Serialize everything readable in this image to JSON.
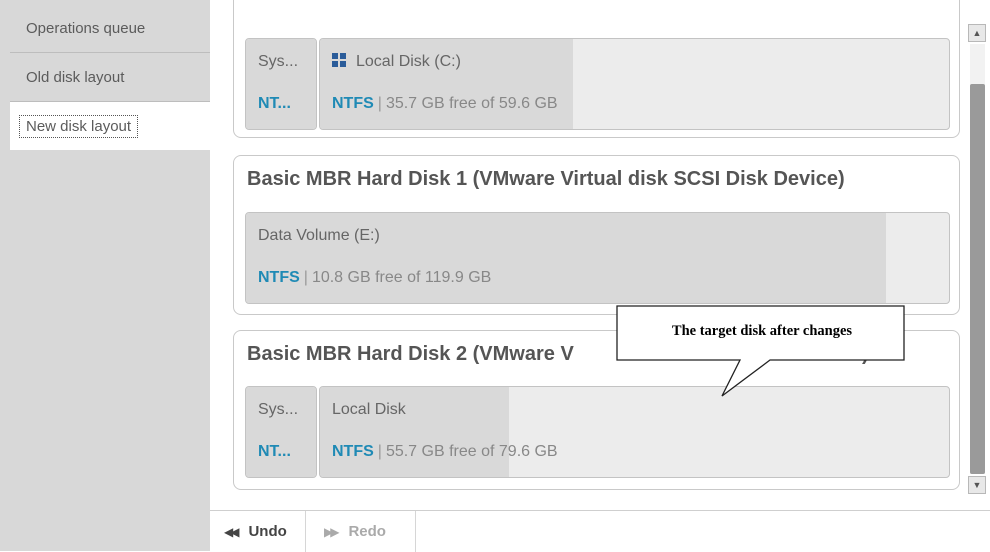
{
  "sidebar": {
    "tabs": [
      {
        "label": "Operations queue"
      },
      {
        "label": "Old disk layout"
      },
      {
        "label": "New disk layout",
        "selected": true
      }
    ]
  },
  "disks": [
    {
      "title": "",
      "partitions": [
        {
          "name": "Sys...",
          "fs": "NT...",
          "detail": "",
          "used_fraction": 1.0
        },
        {
          "name": "Local Disk (C:)",
          "icon": "windows-icon",
          "fs": "NTFS",
          "detail": "35.7 GB free of 59.6 GB",
          "used_fraction": 0.4
        }
      ]
    },
    {
      "title": "Basic MBR Hard Disk 1 (VMware Virtual disk SCSI Disk Device)",
      "partitions": [
        {
          "name": "Data Volume (E:)",
          "fs": "NTFS",
          "detail": "10.8 GB free of 119.9 GB",
          "used_fraction": 0.91
        }
      ]
    },
    {
      "title_left": "Basic MBR Hard Disk 2 (VMware V",
      "title_right": "ce)",
      "partitions": [
        {
          "name": "Sys...",
          "fs": "NT...",
          "detail": "",
          "used_fraction": 1.0
        },
        {
          "name": "Local Disk",
          "fs": "NTFS",
          "detail": "55.7 GB free of 79.6 GB",
          "used_fraction": 0.3
        }
      ]
    }
  ],
  "callout": {
    "text": "The target disk after changes"
  },
  "toolbar": {
    "undo_label": "Undo",
    "redo_label": "Redo"
  },
  "colors": {
    "sidebar_bg": "#d8d8d8",
    "ntfs_accent": "#1f8ab5",
    "scroll_thumb": "#9a9a9a"
  }
}
